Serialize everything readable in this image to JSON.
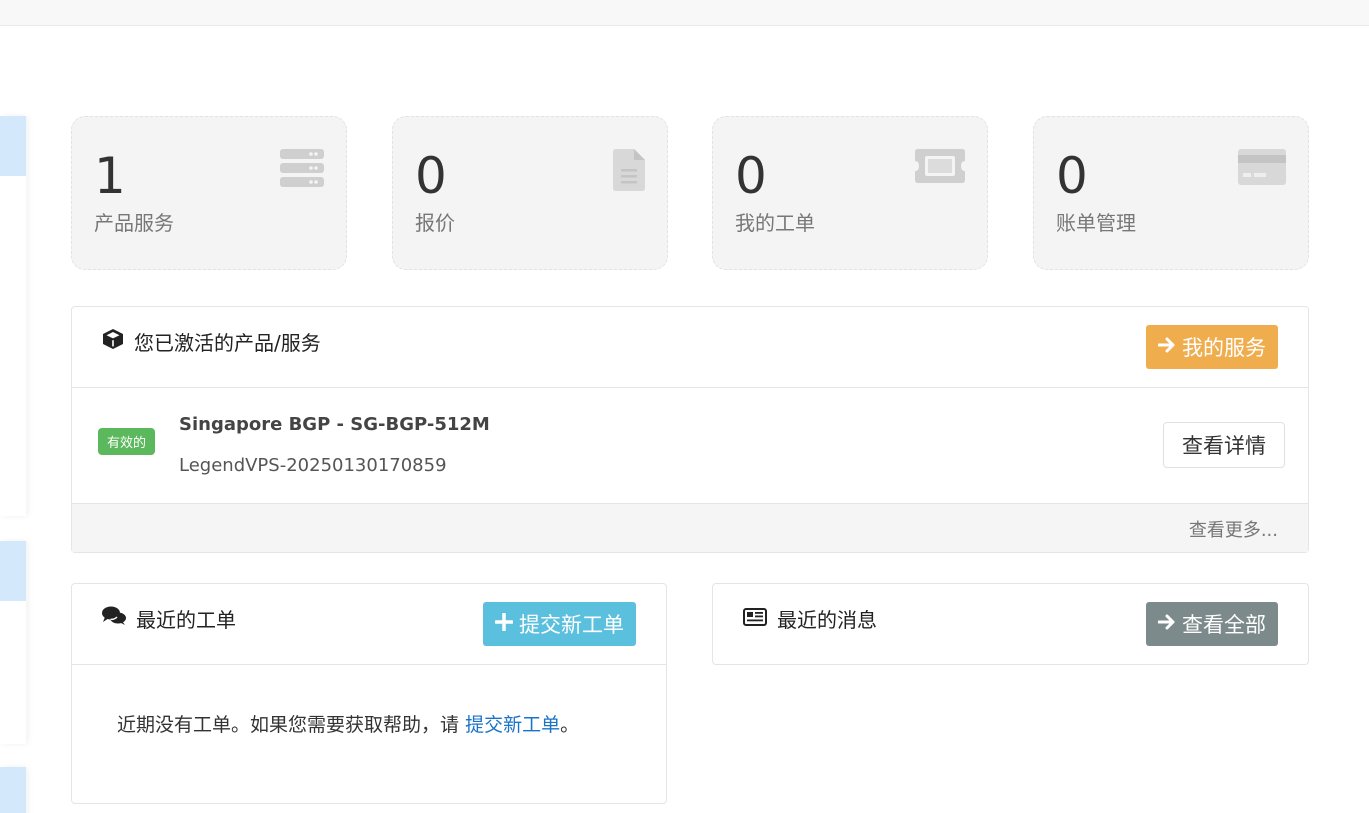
{
  "colors": {
    "accent_orange": "#f0ad4e",
    "accent_cyan": "#5bc0de",
    "accent_gray": "#7d8a8b",
    "status_green": "#5cb85c",
    "link_blue": "#1a73c8"
  },
  "stats": [
    {
      "value": "1",
      "label": "产品服务",
      "icon": "server-icon"
    },
    {
      "value": "0",
      "label": "报价",
      "icon": "document-icon"
    },
    {
      "value": "0",
      "label": "我的工单",
      "icon": "ticket-icon"
    },
    {
      "value": "0",
      "label": "账单管理",
      "icon": "credit-card-icon"
    }
  ],
  "services_panel": {
    "title": "您已激活的产品/服务",
    "title_icon": "cube-icon",
    "button_label": "我的服务",
    "items": [
      {
        "status": "有效的",
        "name": "Singapore BGP - SG-BGP-512M",
        "domain": "LegendVPS-20250130170859",
        "action_label": "查看详情"
      }
    ],
    "more_label": "查看更多..."
  },
  "tickets_panel": {
    "title": "最近的工单",
    "title_icon": "comments-icon",
    "button_label": "提交新工单",
    "empty_text": "近期没有工单。如果您需要获取帮助，请",
    "empty_link": "提交新工单",
    "empty_suffix": "。"
  },
  "news_panel": {
    "title": "最近的消息",
    "title_icon": "newspaper-icon",
    "button_label": "查看全部"
  }
}
